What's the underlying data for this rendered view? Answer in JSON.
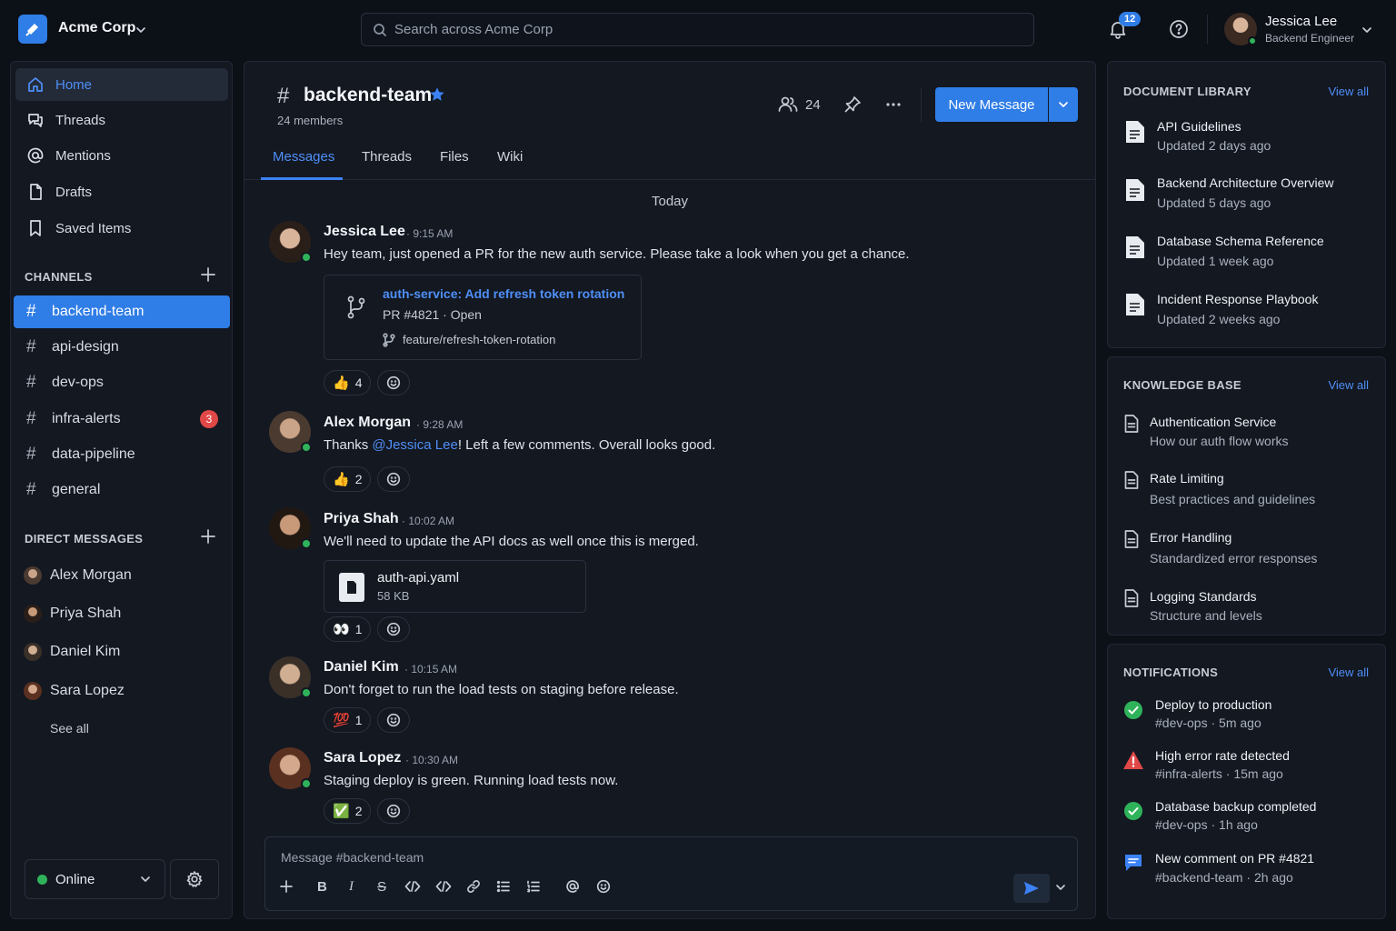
{
  "workspace": {
    "name": "Acme Corp"
  },
  "search": {
    "placeholder": "Search across Acme Corp"
  },
  "header": {
    "notification_count": "12",
    "user_name": "Jessica Lee",
    "user_role": "Backend Engineer"
  },
  "colors": {
    "accent": "#2f7de6",
    "online": "#2fb35a",
    "badge_red": "#e04848",
    "warning": "#e04848"
  },
  "sidebar": {
    "nav": [
      {
        "label": "Home",
        "icon": "home-icon"
      },
      {
        "label": "Threads",
        "icon": "threads-icon"
      },
      {
        "label": "Mentions",
        "icon": "at-icon"
      },
      {
        "label": "Drafts",
        "icon": "file-icon"
      },
      {
        "label": "Saved Items",
        "icon": "bookmark-icon"
      }
    ],
    "channels_heading": "CHANNELS",
    "channels": [
      {
        "name": "backend-team"
      },
      {
        "name": "api-design"
      },
      {
        "name": "dev-ops"
      },
      {
        "name": "infra-alerts",
        "unread": "3"
      },
      {
        "name": "data-pipeline"
      },
      {
        "name": "general"
      }
    ],
    "dm_heading": "DIRECT MESSAGES",
    "dms": [
      {
        "name": "Alex Morgan"
      },
      {
        "name": "Priya Shah"
      },
      {
        "name": "Daniel Kim"
      },
      {
        "name": "Sara Lopez"
      }
    ],
    "see_all": "See all",
    "status": "Online"
  },
  "channel": {
    "hash": "#",
    "name": "backend-team",
    "members_label": "24 members",
    "member_count": "24",
    "new_message": "New Message",
    "tabs": [
      "Messages",
      "Threads",
      "Files",
      "Wiki"
    ],
    "day_divider": "Today"
  },
  "messages": [
    {
      "author": "Jessica Lee",
      "time": "9:15 AM",
      "text": "Hey team, just opened a PR for the new auth service. Please take a look when you get a chance.",
      "pr": {
        "title": "auth-service: Add refresh token rotation",
        "meta": "PR #4821 · Open",
        "branch": "feature/refresh-token-rotation"
      },
      "reaction": {
        "emoji": "👍",
        "count": "4"
      }
    },
    {
      "author": "Alex Morgan",
      "time": "9:28 AM",
      "text_before": "Thanks ",
      "mention": "@Jessica Lee",
      "text_after": "! Left a few comments. Overall looks good.",
      "reaction": {
        "emoji": "👍",
        "count": "2"
      }
    },
    {
      "author": "Priya Shah",
      "time": "10:02 AM",
      "text": "We'll need to update the API docs as well once this is merged.",
      "file": {
        "name": "auth-api.yaml",
        "size": "58 KB"
      },
      "reaction": {
        "emoji": "👀",
        "count": "1"
      }
    },
    {
      "author": "Daniel Kim",
      "time": "10:15 AM",
      "text": "Don't forget to run the load tests on staging before release.",
      "reaction": {
        "emoji": "💯",
        "count": "1"
      }
    },
    {
      "author": "Sara Lopez",
      "time": "10:30 AM",
      "text": "Staging deploy is green. Running load tests now.",
      "reaction": {
        "emoji": "✅",
        "count": "2"
      }
    }
  ],
  "composer": {
    "placeholder": "Message #backend-team"
  },
  "doc_library": {
    "heading": "DOCUMENT LIBRARY",
    "view_all": "View all",
    "items": [
      {
        "title": "API Guidelines",
        "sub": "Updated 2 days ago"
      },
      {
        "title": "Backend Architecture Overview",
        "sub": "Updated 5 days ago"
      },
      {
        "title": "Database Schema Reference",
        "sub": "Updated 1 week ago"
      },
      {
        "title": "Incident Response Playbook",
        "sub": "Updated 2 weeks ago"
      }
    ]
  },
  "knowledge_base": {
    "heading": "KNOWLEDGE BASE",
    "view_all": "View all",
    "items": [
      {
        "title": "Authentication Service",
        "sub": "How our auth flow works"
      },
      {
        "title": "Rate Limiting",
        "sub": "Best practices and guidelines"
      },
      {
        "title": "Error Handling",
        "sub": "Standardized error responses"
      },
      {
        "title": "Logging Standards",
        "sub": "Structure and levels"
      }
    ]
  },
  "notifications": {
    "heading": "NOTIFICATIONS",
    "view_all": "View all",
    "items": [
      {
        "title": "Deploy to production",
        "sub": "#dev-ops · 5m ago",
        "icon": "check-circle-icon"
      },
      {
        "title": "High error rate detected",
        "sub": "#infra-alerts · 15m ago",
        "icon": "warning-icon"
      },
      {
        "title": "Database backup completed",
        "sub": "#dev-ops · 1h ago",
        "icon": "check-circle-icon"
      },
      {
        "title": "New comment on PR #4821",
        "sub": "#backend-team · 2h ago",
        "icon": "comment-icon"
      }
    ]
  }
}
